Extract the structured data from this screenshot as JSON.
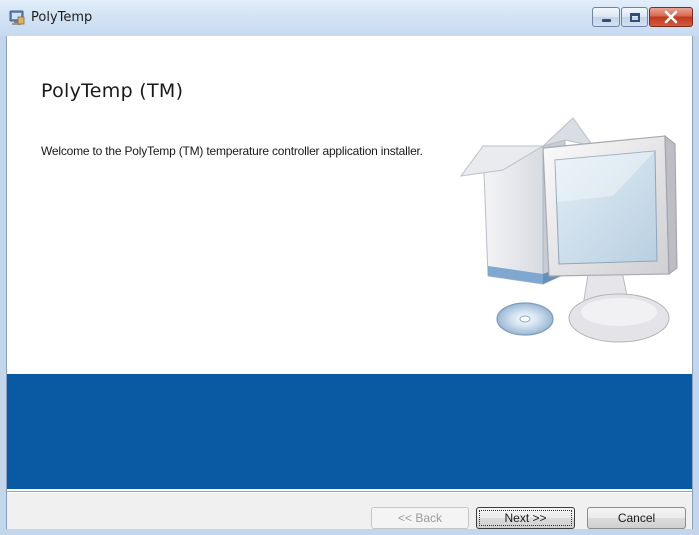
{
  "window": {
    "title": "PolyTemp"
  },
  "content": {
    "heading": "PolyTemp (TM)",
    "welcome_text": "Welcome to the PolyTemp (TM) temperature controller application installer."
  },
  "buttons": {
    "back": "<< Back",
    "next": "Next >>",
    "cancel": "Cancel"
  },
  "icons": {
    "app": "installer-icon",
    "minimize": "minimize-icon",
    "maximize": "maximize-icon",
    "close": "close-icon",
    "illustration": "computer-with-box-and-disc"
  },
  "colors": {
    "banner": "#0a5aa3",
    "titlebar": "#d3e3f5",
    "close_button": "#c2371d"
  },
  "state": {
    "back_enabled": false,
    "focused_button": "next"
  }
}
